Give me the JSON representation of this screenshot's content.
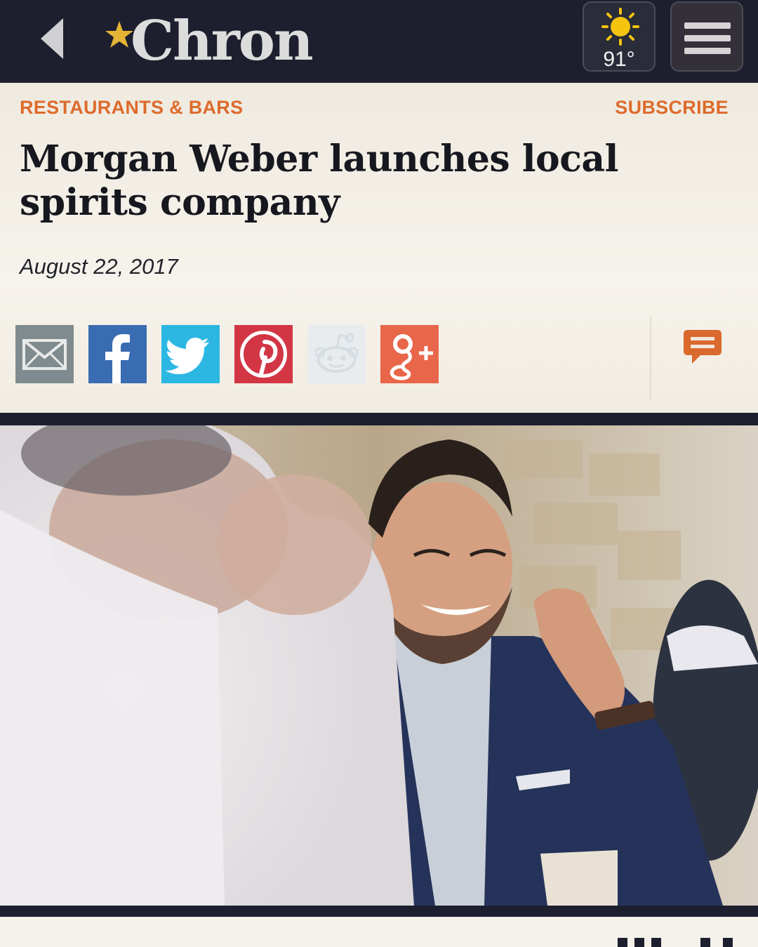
{
  "header": {
    "logo_text": "Chron",
    "weather": {
      "temperature": "91°",
      "icon": "sun-icon"
    },
    "back_icon": "chevron-left-icon",
    "menu_icon": "hamburger-menu-icon"
  },
  "article": {
    "section": "RESTAURANTS & BARS",
    "subscribe_label": "SUBSCRIBE",
    "headline": "Morgan Weber launches local spirits company",
    "date": "August 22, 2017"
  },
  "share": [
    {
      "name": "email-share-button",
      "icon": "envelope-icon",
      "color": "#7f8b8e"
    },
    {
      "name": "facebook-share-button",
      "icon": "facebook-icon",
      "color": "#3a6cb1"
    },
    {
      "name": "twitter-share-button",
      "icon": "twitter-icon",
      "color": "#2cb7e3"
    },
    {
      "name": "pinterest-share-button",
      "icon": "pinterest-icon",
      "color": "#d23645"
    },
    {
      "name": "reddit-share-button",
      "icon": "reddit-icon",
      "color": "#e8ecef"
    },
    {
      "name": "googleplus-share-button",
      "icon": "google-plus-icon",
      "color": "#e8674a"
    }
  ],
  "colors": {
    "accent": "#dd6b2c",
    "topbar": "#1d1f2e",
    "background": "#f4f1ea"
  }
}
